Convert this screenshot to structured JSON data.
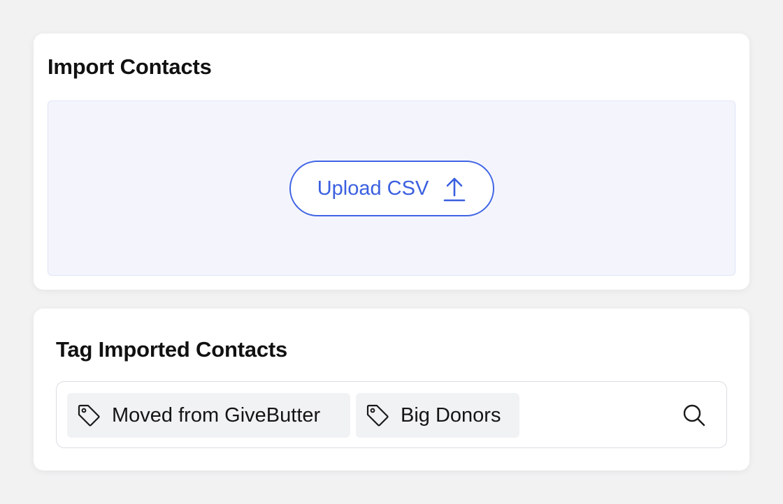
{
  "import_card": {
    "title": "Import Contacts",
    "upload_button": {
      "label": "Upload CSV",
      "icon": "upload-icon"
    }
  },
  "tag_card": {
    "title": "Tag Imported Contacts",
    "tags": [
      {
        "label": "Moved from GiveButter",
        "icon": "tag-icon"
      },
      {
        "label": "Big Donors",
        "icon": "tag-icon"
      }
    ],
    "search_icon": "search-icon"
  },
  "colors": {
    "accent": "#3f64e4",
    "dropzone_bg": "#f4f5fc",
    "chip_bg": "#f1f2f4",
    "page_bg": "#f2f2f3"
  }
}
